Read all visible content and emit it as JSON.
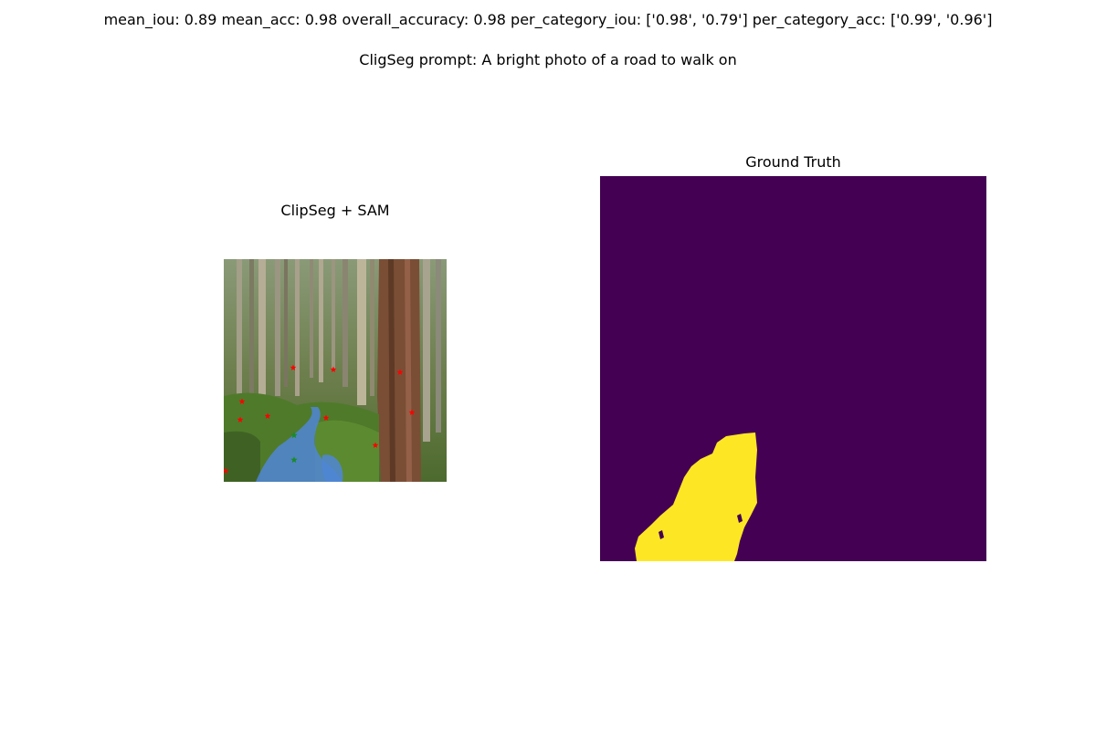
{
  "header": {
    "metrics": "mean_iou: 0.89  mean_acc: 0.98  overall_accuracy: 0.98  per_category_iou: ['0.98', '0.79']  per_category_acc: ['0.99', '0.96']",
    "prompt": "CligSeg prompt: A bright photo of a road to walk on"
  },
  "panels": {
    "left_title": "ClipSeg + SAM",
    "right_title": "Ground Truth"
  },
  "colors": {
    "mask_overlay": "#4f86d6",
    "negative_point": "#ff0000",
    "positive_point": "#1a8a2a",
    "gt_background": "#440154",
    "gt_foreground": "#fde725"
  },
  "icons": {
    "negative_point": "red-star-marker",
    "positive_point": "green-star-marker"
  }
}
